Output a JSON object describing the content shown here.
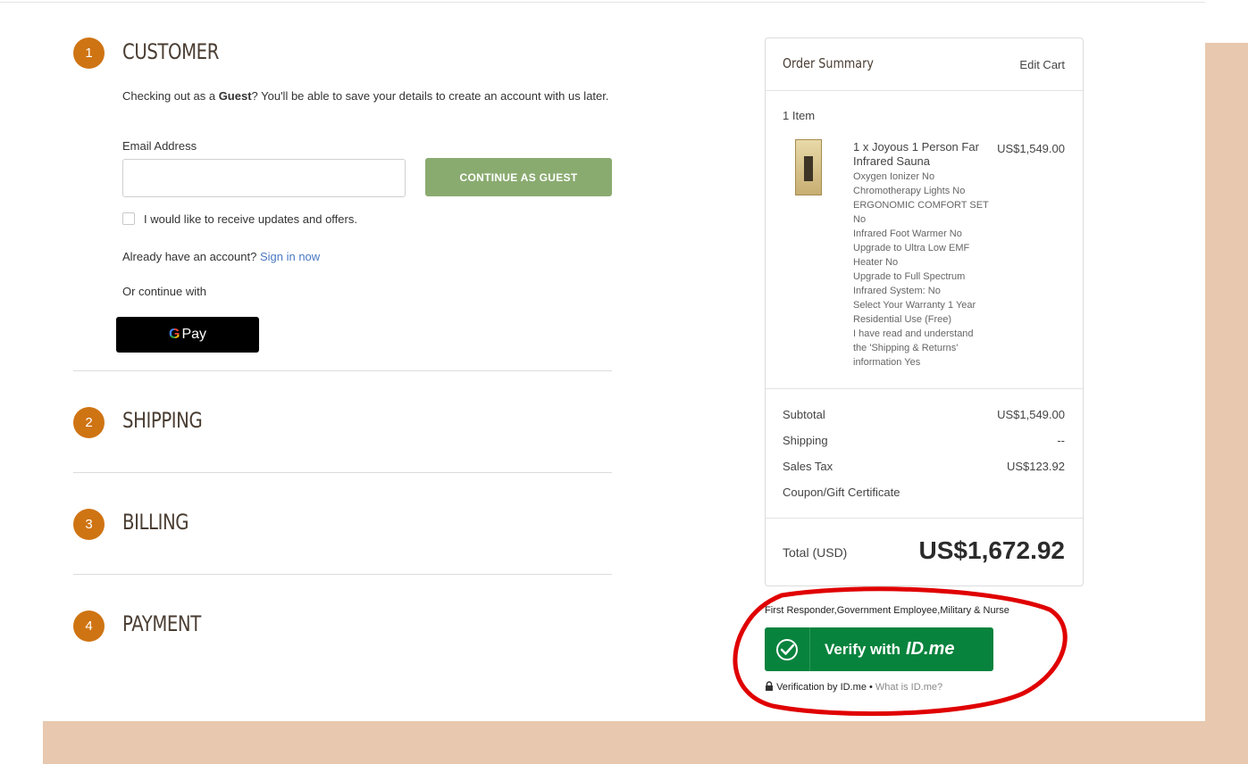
{
  "checkout": {
    "steps": [
      {
        "number": "1",
        "title": "CUSTOMER"
      },
      {
        "number": "2",
        "title": "SHIPPING"
      },
      {
        "number": "3",
        "title": "BILLING"
      },
      {
        "number": "4",
        "title": "PAYMENT"
      }
    ],
    "customer": {
      "guest_intro_prefix": "Checking out as a ",
      "guest_intro_bold": "Guest",
      "guest_intro_suffix": "? You'll be able to save your details to create an account with us later.",
      "email_label": "Email Address",
      "email_value": "",
      "continue_button": "CONTINUE AS GUEST",
      "updates_label": "I would like to receive updates and offers.",
      "account_prompt": "Already have an account?",
      "sign_in_link": "Sign in now",
      "or_continue": "Or continue with",
      "gpay_label": "Pay",
      "gpay_g": "G"
    }
  },
  "summary": {
    "title": "Order Summary",
    "edit_cart": "Edit Cart",
    "item_count": "1 Item",
    "item": {
      "name": "1 x Joyous 1 Person Far Infrared Sauna",
      "price": "US$1,549.00",
      "options": [
        "Oxygen Ionizer No",
        "Chromotherapy Lights No",
        "ERGONOMIC COMFORT SET No",
        "Infrared Foot Warmer No",
        "Upgrade to Ultra Low EMF Heater No",
        "Upgrade to Full Spectrum Infrared System: No",
        "Select Your Warranty 1 Year Residential Use (Free)",
        "I have read and understand the 'Shipping & Returns' information Yes"
      ]
    },
    "subtotal_label": "Subtotal",
    "subtotal_value": "US$1,549.00",
    "shipping_label": "Shipping",
    "shipping_value": "--",
    "tax_label": "Sales Tax",
    "tax_value": "US$123.92",
    "coupon_link": "Coupon/Gift Certificate",
    "total_label": "Total (USD)",
    "total_value": "US$1,672.92"
  },
  "idme": {
    "groups": "First Responder,Government Employee,Military & Nurse",
    "button_text": "Verify with",
    "brand": "ID.me",
    "verification_text": "Verification by ID.me",
    "separator": "•",
    "what_is": "What is ID.me?"
  },
  "colors": {
    "step_badge": "#cf7413",
    "guest_button": "#8aab70",
    "idme_green": "#08833d",
    "link": "#4a78c4",
    "peach_background": "#e8c8ae",
    "annotation_red": "#e00000"
  }
}
